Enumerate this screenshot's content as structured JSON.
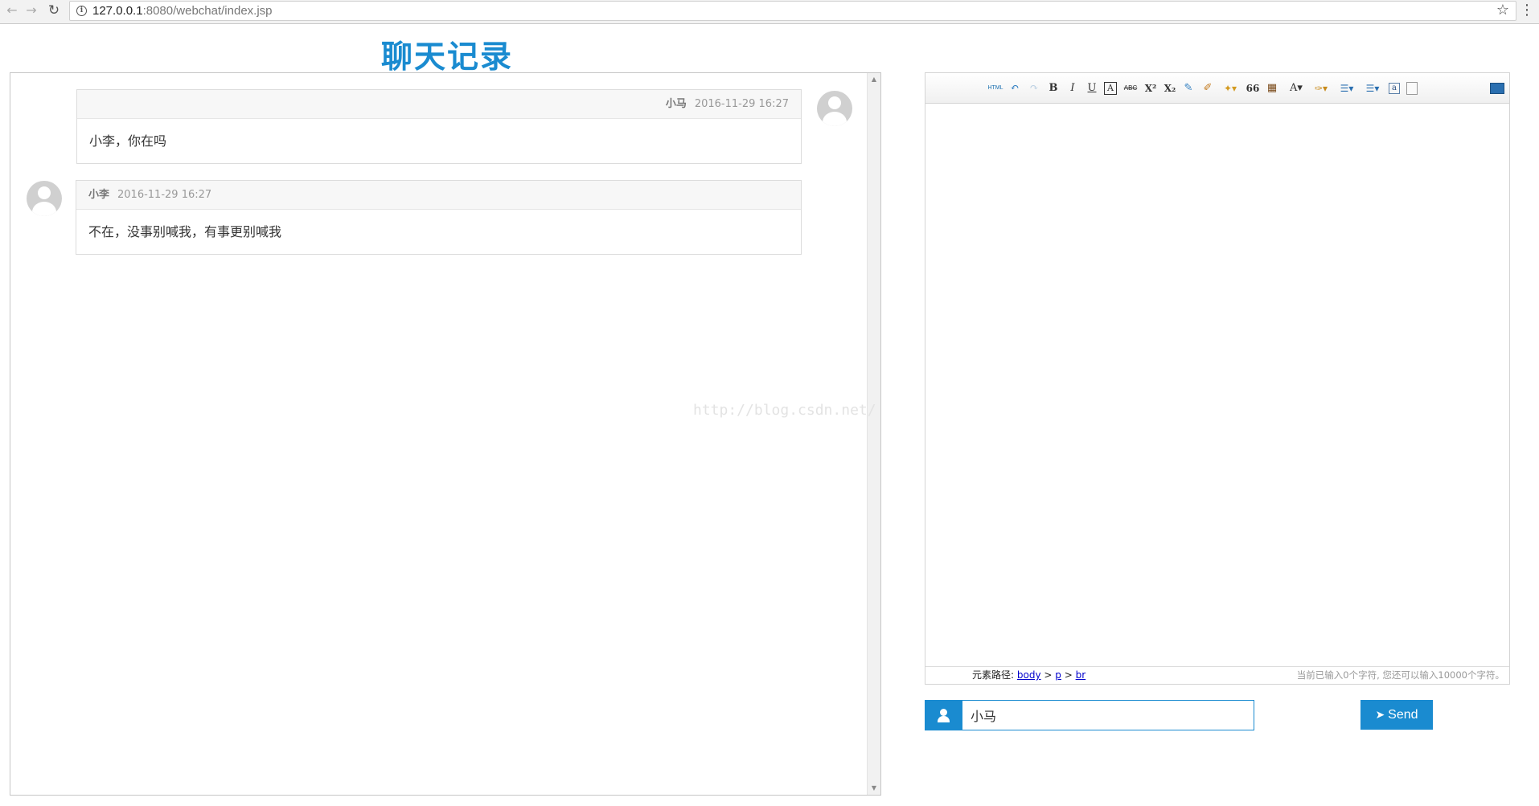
{
  "browser": {
    "url_host": "127.0.0.1",
    "url_rest": ":8080/webchat/index.jsp"
  },
  "page": {
    "title": "聊天记录"
  },
  "messages": [
    {
      "name": "小马",
      "time": "2016-11-29 16:27",
      "text": "小李，你在吗",
      "side": "right"
    },
    {
      "name": "小李",
      "time": "2016-11-29 16:27",
      "text": "不在，没事别喊我，有事更别喊我",
      "side": "left"
    }
  ],
  "watermark": "http://blog.csdn.net/",
  "editor": {
    "toolbar": {
      "html": "HTML",
      "bold": "B",
      "italic": "I",
      "underline": "U",
      "font_border": "A",
      "strike": "ABC",
      "superscript": "X²",
      "subscript": "X₂",
      "blockquote": "66",
      "font_color": "A",
      "insert_code": "a"
    },
    "status": {
      "path_label": "元素路径:",
      "path": [
        "body",
        "p",
        "br"
      ],
      "path_sep": ">",
      "char_count": "当前已输入0个字符, 您还可以输入10000个字符。"
    }
  },
  "name_input": {
    "value": "小马"
  },
  "send_button": {
    "label": "Send"
  },
  "colors": {
    "accent": "#1a8bd0"
  }
}
